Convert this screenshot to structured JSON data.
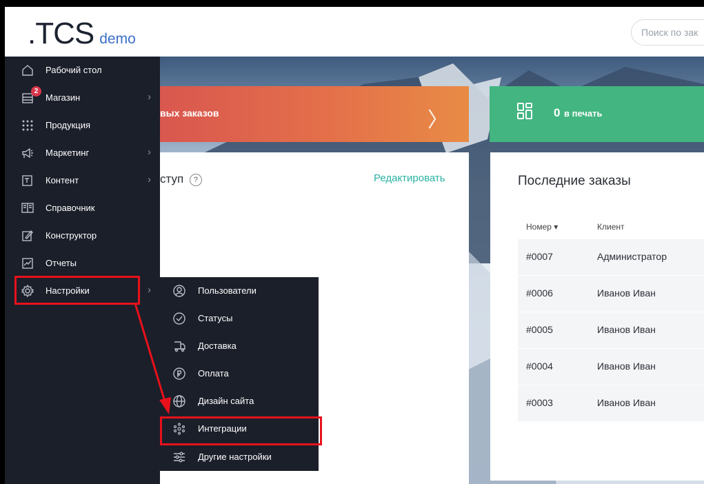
{
  "header": {
    "logo_main": ".TCS",
    "logo_sub": "demo",
    "search_placeholder": "Поиск по зак"
  },
  "sidebar": {
    "items": [
      {
        "label": "Рабочий стол",
        "icon": "home-icon",
        "arrow": false
      },
      {
        "label": "Магазин",
        "icon": "store-icon",
        "arrow": true,
        "badge": "2"
      },
      {
        "label": "Продукция",
        "icon": "grid-dots-icon",
        "arrow": false
      },
      {
        "label": "Маркетинг",
        "icon": "megaphone-icon",
        "arrow": true
      },
      {
        "label": "Контент",
        "icon": "content-icon",
        "arrow": true
      },
      {
        "label": "Справочник",
        "icon": "book-icon",
        "arrow": false
      },
      {
        "label": "Конструктор",
        "icon": "constructor-icon",
        "arrow": false
      },
      {
        "label": "Отчеты",
        "icon": "chart-icon",
        "arrow": false
      },
      {
        "label": "Настройки",
        "icon": "gear-icon",
        "arrow": true
      }
    ],
    "arrow_glyph": "›"
  },
  "submenu": {
    "items": [
      {
        "label": "Пользователи",
        "icon": "user-icon"
      },
      {
        "label": "Статусы",
        "icon": "check-circle-icon"
      },
      {
        "label": "Доставка",
        "icon": "delivery-icon"
      },
      {
        "label": "Оплата",
        "icon": "ruble-icon"
      },
      {
        "label": "Дизайн сайта",
        "icon": "globe-icon"
      },
      {
        "label": "Интеграции",
        "icon": "integrations-icon"
      },
      {
        "label": "Другие настройки",
        "icon": "sliders-icon"
      }
    ]
  },
  "cards": {
    "orange_label": "вых заказов",
    "orange_chevron": "〉",
    "green_count": "0",
    "green_label": "в печать"
  },
  "left_panel": {
    "title": "ступ",
    "help": "?",
    "edit_link": "Редактировать"
  },
  "orders": {
    "title": "Последние заказы",
    "col_number": "Номер ▾",
    "col_client": "Клиент",
    "rows": [
      {
        "number": "#0007",
        "client": "Администратор"
      },
      {
        "number": "#0006",
        "client": "Иванов Иван"
      },
      {
        "number": "#0005",
        "client": "Иванов Иван"
      },
      {
        "number": "#0004",
        "client": "Иванов Иван"
      },
      {
        "number": "#0003",
        "client": "Иванов Иван"
      }
    ]
  },
  "colors": {
    "accent_red": "#e8111b",
    "sidebar_bg": "#1b1f2a",
    "green": "#43b581",
    "teal_link": "#2bb3a3"
  }
}
